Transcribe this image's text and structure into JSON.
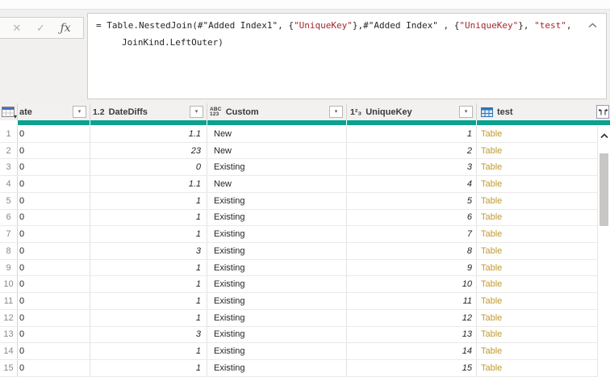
{
  "colors": {
    "quality_bar_teal": "#0aa28e",
    "formula_string_red": "#a4262c",
    "table_link_gold": "#c19a2f"
  },
  "glyphs": {
    "caret_down": "▾"
  },
  "formula_bar": {
    "cancel_label": "✕",
    "confirm_label": "✓",
    "fx_label": "ƒx",
    "formula_line1_segments": [
      {
        "type": "plain",
        "text": "= Table.NestedJoin(#\"Added Index1\", {"
      },
      {
        "type": "string",
        "text": "\"UniqueKey\""
      },
      {
        "type": "plain",
        "text": "},#\"Added Index\" , {"
      },
      {
        "type": "string",
        "text": "\"UniqueKey\""
      },
      {
        "type": "plain",
        "text": "}, "
      },
      {
        "type": "string",
        "text": "\"test\""
      },
      {
        "type": "plain",
        "text": ","
      }
    ],
    "formula_line2": "JoinKind.LeftOuter)"
  },
  "grid": {
    "columns": [
      {
        "label": "ate"
      },
      {
        "label": "DateDiffs",
        "type_icon": "1.2"
      },
      {
        "label": "Custom",
        "type_icon_top": "ABC",
        "type_icon_bottom": "123"
      },
      {
        "label": "UniqueKey",
        "type_icon": "1²₃"
      },
      {
        "label": "test"
      }
    ],
    "rows": [
      {
        "n": "1",
        "ate": "0",
        "datediffs": "1.1",
        "custom": "New",
        "uniquekey": "1",
        "test": "Table"
      },
      {
        "n": "2",
        "ate": "0",
        "datediffs": "23",
        "custom": "New",
        "uniquekey": "2",
        "test": "Table"
      },
      {
        "n": "3",
        "ate": "0",
        "datediffs": "0",
        "custom": "Existing",
        "uniquekey": "3",
        "test": "Table"
      },
      {
        "n": "4",
        "ate": "0",
        "datediffs": "1.1",
        "custom": "New",
        "uniquekey": "4",
        "test": "Table"
      },
      {
        "n": "5",
        "ate": "0",
        "datediffs": "1",
        "custom": "Existing",
        "uniquekey": "5",
        "test": "Table"
      },
      {
        "n": "6",
        "ate": "0",
        "datediffs": "1",
        "custom": "Existing",
        "uniquekey": "6",
        "test": "Table"
      },
      {
        "n": "7",
        "ate": "0",
        "datediffs": "1",
        "custom": "Existing",
        "uniquekey": "7",
        "test": "Table"
      },
      {
        "n": "8",
        "ate": "0",
        "datediffs": "3",
        "custom": "Existing",
        "uniquekey": "8",
        "test": "Table"
      },
      {
        "n": "9",
        "ate": "0",
        "datediffs": "1",
        "custom": "Existing",
        "uniquekey": "9",
        "test": "Table"
      },
      {
        "n": "10",
        "ate": "0",
        "datediffs": "1",
        "custom": "Existing",
        "uniquekey": "10",
        "test": "Table"
      },
      {
        "n": "11",
        "ate": "0",
        "datediffs": "1",
        "custom": "Existing",
        "uniquekey": "11",
        "test": "Table"
      },
      {
        "n": "12",
        "ate": "0",
        "datediffs": "1",
        "custom": "Existing",
        "uniquekey": "12",
        "test": "Table"
      },
      {
        "n": "13",
        "ate": "0",
        "datediffs": "3",
        "custom": "Existing",
        "uniquekey": "13",
        "test": "Table"
      },
      {
        "n": "14",
        "ate": "0",
        "datediffs": "1",
        "custom": "Existing",
        "uniquekey": "14",
        "test": "Table"
      },
      {
        "n": "15",
        "ate": "0",
        "datediffs": "1",
        "custom": "Existing",
        "uniquekey": "15",
        "test": "Table"
      }
    ]
  }
}
